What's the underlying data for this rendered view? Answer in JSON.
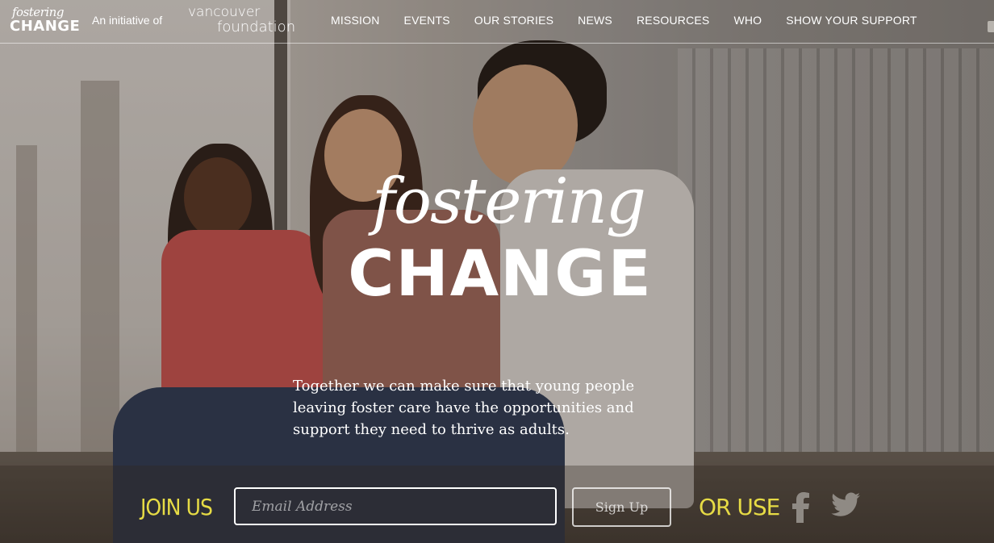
{
  "header": {
    "brand_script": "fostering",
    "brand_caps": "CHANGE",
    "initiative_text": "An initiative of",
    "partner_line1": "vancouver",
    "partner_line2": "foundation",
    "nav": [
      "MISSION",
      "EVENTS",
      "OUR STORIES",
      "NEWS",
      "RESOURCES",
      "WHO",
      "SHOW YOUR SUPPORT"
    ]
  },
  "hero": {
    "logo_script": "fostering",
    "logo_caps": "CHANGE",
    "tagline": "Together we can make sure that young people leaving foster care have the opportunities and support they need to thrive as adults."
  },
  "signup": {
    "join_label": "JOIN US",
    "email_placeholder": "Email Address",
    "button_label": "Sign Up",
    "or_use_label": "OR USE",
    "social": [
      "facebook-icon",
      "twitter-icon"
    ]
  },
  "colors": {
    "accent": "#e6db45",
    "text": "#ffffff"
  }
}
